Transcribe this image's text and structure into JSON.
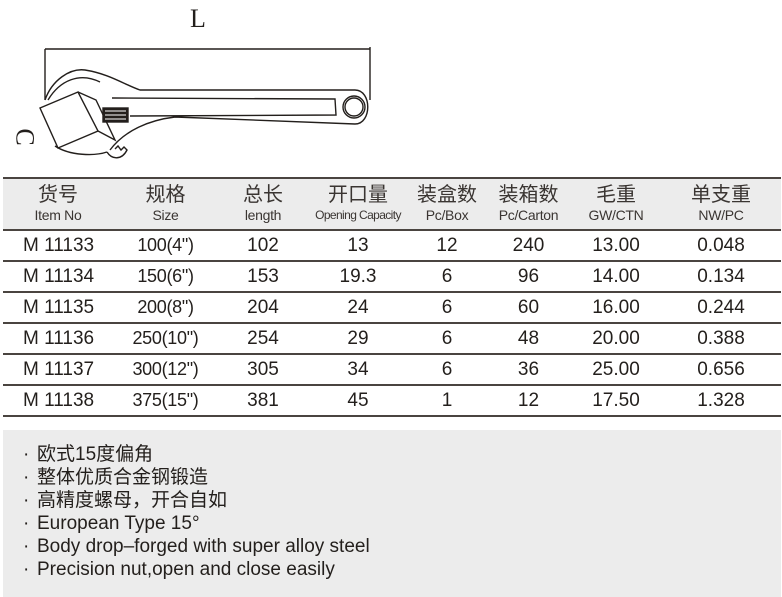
{
  "diagram": {
    "dimension_length_label": "L",
    "dimension_capacity_label": "C",
    "illustration": "adjustable-wrench-icon"
  },
  "table": {
    "columns": [
      {
        "cn": "货号",
        "en": "Item No"
      },
      {
        "cn": "规格",
        "en": "Size"
      },
      {
        "cn": "总长",
        "en": "length"
      },
      {
        "cn": "开口量",
        "en": "Opening Capacity"
      },
      {
        "cn": "装盒数",
        "en": "Pc/Box"
      },
      {
        "cn": "装箱数",
        "en": "Pc/Carton"
      },
      {
        "cn": "毛重",
        "en": "GW/CTN"
      },
      {
        "cn": "单支重",
        "en": "NW/PC"
      }
    ],
    "rows": [
      [
        "M 11133",
        "100(4\")",
        "102",
        "13",
        "12",
        "240",
        "13.00",
        "0.048"
      ],
      [
        "M 11134",
        "150(6\")",
        "153",
        "19.3",
        "6",
        "96",
        "14.00",
        "0.134"
      ],
      [
        "M 11135",
        "200(8\")",
        "204",
        "24",
        "6",
        "60",
        "16.00",
        "0.244"
      ],
      [
        "M 11136",
        "250(10\")",
        "254",
        "29",
        "6",
        "48",
        "20.00",
        "0.388"
      ],
      [
        "M 11137",
        "300(12\")",
        "305",
        "34",
        "6",
        "36",
        "25.00",
        "0.656"
      ],
      [
        "M 11138",
        "375(15\")",
        "381",
        "45",
        "1",
        "12",
        "17.50",
        "1.328"
      ]
    ]
  },
  "features": {
    "bullet": "·",
    "items": [
      "欧式15度偏角",
      "整体优质合金钢锻造",
      "高精度螺母，开合自如",
      "European Type 15°",
      "Body drop–forged with super alloy steel",
      "Precision nut,open and close easily"
    ]
  }
}
